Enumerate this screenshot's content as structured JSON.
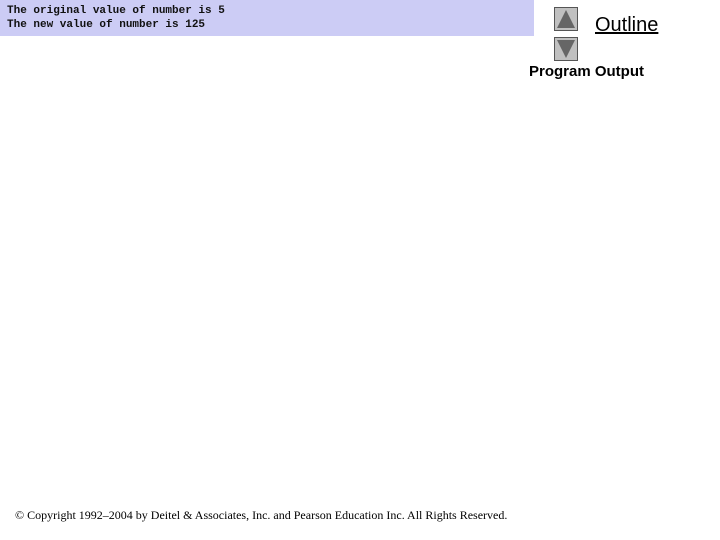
{
  "program_output": {
    "lines": [
      "The original value of number is 5",
      "The new value of number is 125"
    ],
    "background_color": "#ccccf5"
  },
  "navigation": {
    "previous_icon": "triangle-up-icon",
    "next_icon": "triangle-down-icon",
    "outline_label": "Outline"
  },
  "sidebar": {
    "section_label": "Program Output"
  },
  "footer": {
    "copyright": "© Copyright 1992–2004 by Deitel & Associates, Inc. and Pearson Education Inc. All Rights Reserved."
  }
}
